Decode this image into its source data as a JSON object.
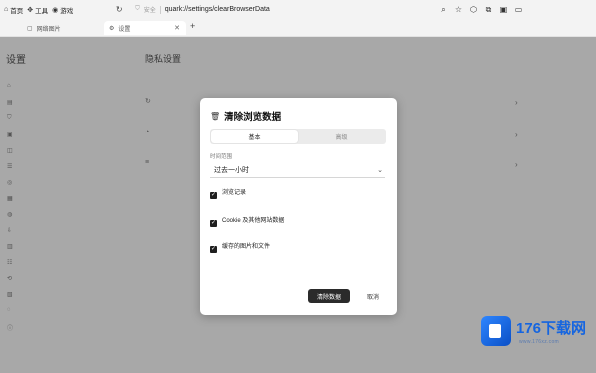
{
  "topbar": {
    "items": [
      {
        "icon": "home-icon",
        "label": "首页"
      },
      {
        "icon": "tools-icon",
        "label": "工具"
      },
      {
        "icon": "game-icon",
        "label": "游戏"
      }
    ],
    "address": {
      "secure_label": "安全",
      "url": "quark://settings/clearBrowserData"
    }
  },
  "tabs": {
    "inactive_label": "网络图片",
    "active_label": "设置"
  },
  "settings": {
    "sidebar_title": "设置",
    "main_title": "隐私设置"
  },
  "dialog": {
    "title": "清除浏览数据",
    "tabs": {
      "basic": "基本",
      "advanced": "高级"
    },
    "time_range_label": "时间范围",
    "time_range_value": "过去一小时",
    "options": [
      {
        "title": "浏览记录",
        "checked": true
      },
      {
        "title": "Cookie 及其他网站数据",
        "checked": true
      },
      {
        "title": "缓存的图片和文件",
        "checked": true
      }
    ],
    "clear_button": "清除数据",
    "cancel_button": "取消"
  },
  "watermark": {
    "brand": "176下载网",
    "domain": "www.176xz.com"
  }
}
